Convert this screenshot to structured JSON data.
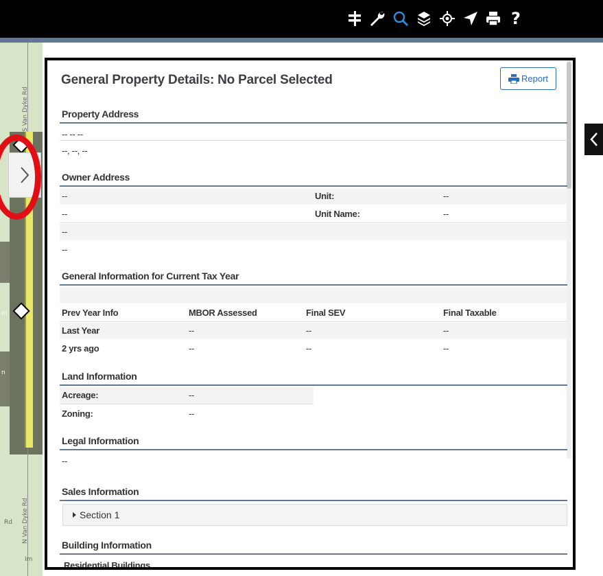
{
  "toolbar": {
    "icons": [
      "road-sign-icon",
      "wrench-icon",
      "search-icon",
      "layers-icon",
      "gps-locate-icon",
      "navigate-arrow-icon",
      "print-icon",
      "help-icon"
    ],
    "help_label": "?",
    "active_color": "#2e8bd6",
    "icon_color": "#ffffff"
  },
  "map": {
    "road_labels": [
      "S Van Dyke Rd",
      "N Van Dyke Rd",
      "Rd",
      "Im",
      "ni",
      "n"
    ]
  },
  "panel": {
    "title": "General Property Details: No Parcel Selected",
    "report_label": "Report",
    "property_address": {
      "heading": "Property Address",
      "line1": "-- -- --",
      "line2": "--, --, --"
    },
    "owner_address": {
      "heading": "Owner Address",
      "rows": [
        {
          "value": "--",
          "label": "Unit:",
          "label_value": "--"
        },
        {
          "value": "--",
          "label": "Unit Name:",
          "label_value": "--"
        },
        {
          "value": "--"
        },
        {
          "value": "--"
        }
      ]
    },
    "general_info": {
      "heading": "General Information for Current Tax Year",
      "columns": [
        "Prev Year Info",
        "MBOR Assessed",
        "Final SEV",
        "Final Taxable"
      ],
      "rows": [
        [
          "Last Year",
          "--",
          "--",
          "--"
        ],
        [
          "2 yrs ago",
          "--",
          "--",
          "--"
        ]
      ]
    },
    "land_info": {
      "heading": "Land Information",
      "rows": [
        {
          "label": "Acreage:",
          "value": "--"
        },
        {
          "label": "Zoning:",
          "value": "--"
        }
      ]
    },
    "legal_info": {
      "heading": "Legal Information",
      "value": "--"
    },
    "sales_info": {
      "heading": "Sales Information",
      "section_label": "Section 1"
    },
    "building_info": {
      "heading": "Building Information",
      "sub_heading": "Residential Buildings"
    }
  }
}
